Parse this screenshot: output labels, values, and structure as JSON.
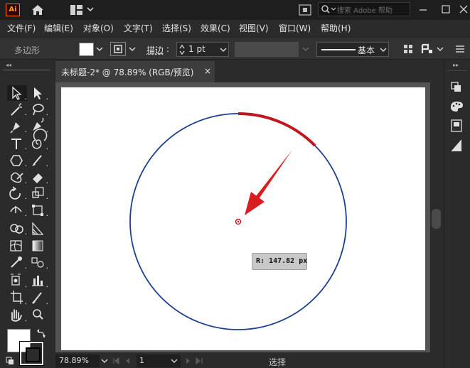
{
  "app": {
    "logo_text": "Ai",
    "search_placeholder": "搜索 Adobe 帮助"
  },
  "menu": {
    "items": [
      "文件(F)",
      "编辑(E)",
      "对象(O)",
      "文字(T)",
      "选择(S)",
      "效果(C)",
      "视图(V)",
      "窗口(W)",
      "帮助(H)"
    ]
  },
  "control": {
    "selection_type": "多边形",
    "stroke_label": "描边",
    "stroke_weight": "1 pt",
    "profile_label": "基本"
  },
  "document": {
    "tab_title": "未标题-2* @ 78.89% (RGB/预览)",
    "close_symbol": "×"
  },
  "canvas": {
    "radius_readout": "R: 147.82 px",
    "circle_color": "#1d3f8f",
    "highlight_arc_color": "#c0161d",
    "arrow_color": "#d81e1e"
  },
  "status": {
    "zoom": "78.89%",
    "artboard_number": "1",
    "current_tool": "选择"
  }
}
